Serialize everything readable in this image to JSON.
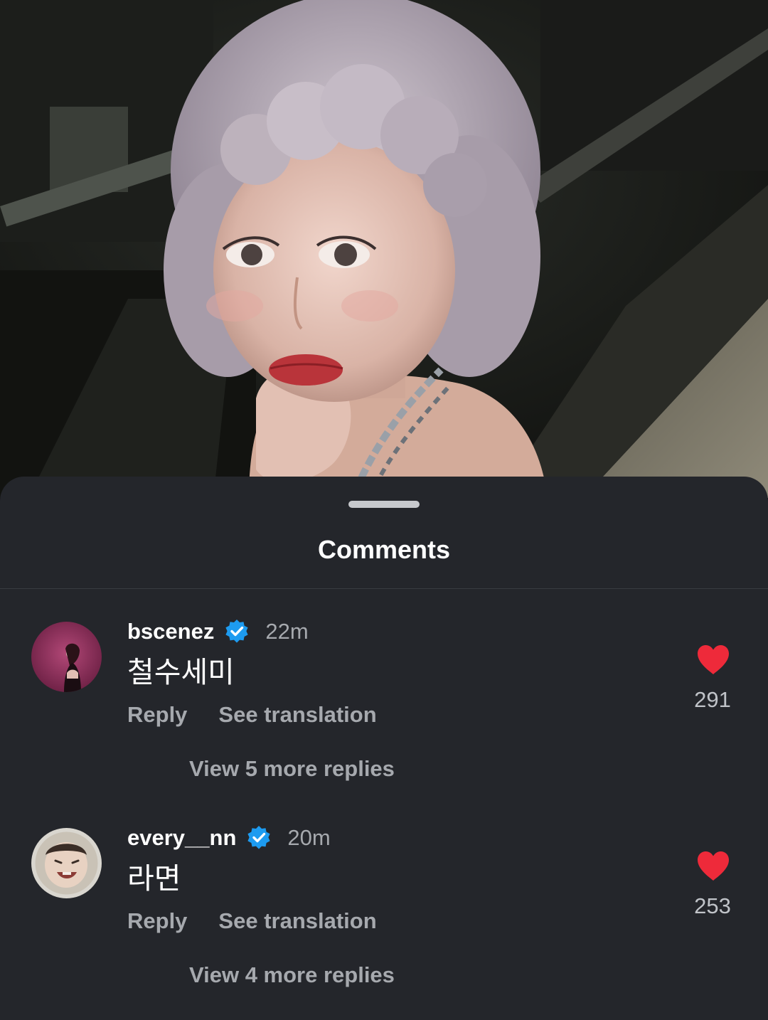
{
  "post": {
    "photo_icon": "post-photo"
  },
  "sheet": {
    "title": "Comments"
  },
  "comments": [
    {
      "username": "bscenez",
      "verified": true,
      "time": "22m",
      "text": "철수세미",
      "reply_label": "Reply",
      "translate_label": "See translation",
      "view_replies_label": "View 5 more replies",
      "likes": "291",
      "liked": true
    },
    {
      "username": "every__nn",
      "verified": true,
      "time": "20m",
      "text": "라면",
      "reply_label": "Reply",
      "translate_label": "See translation",
      "view_replies_label": "View 4 more replies",
      "likes": "253",
      "liked": true
    }
  ],
  "colors": {
    "sheet_bg": "#24262b",
    "text_primary": "#ffffff",
    "text_secondary": "#a6a9ae",
    "heart": "#ee2a3a",
    "verified": "#1d9bf0"
  }
}
